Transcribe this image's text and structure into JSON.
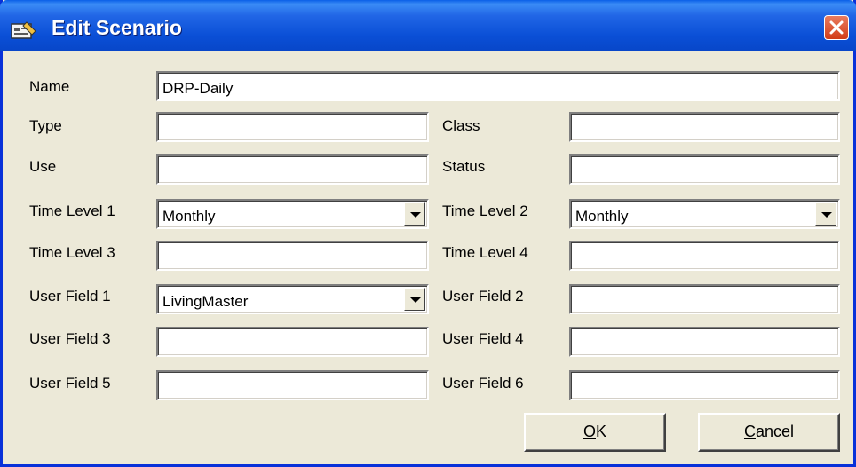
{
  "window": {
    "title": "Edit Scenario"
  },
  "labels": {
    "name": "Name",
    "type": "Type",
    "class": "Class",
    "use": "Use",
    "status": "Status",
    "time_level_1": "Time Level 1",
    "time_level_2": "Time Level 2",
    "time_level_3": "Time Level 3",
    "time_level_4": "Time Level 4",
    "user_field_1": "User Field 1",
    "user_field_2": "User Field 2",
    "user_field_3": "User Field 3",
    "user_field_4": "User Field 4",
    "user_field_5": "User Field 5",
    "user_field_6": "User Field 6"
  },
  "values": {
    "name": "DRP-Daily",
    "type": "",
    "class": "",
    "use": "",
    "status": "",
    "time_level_1": "Monthly",
    "time_level_2": "Monthly",
    "time_level_3": "",
    "time_level_4": "",
    "user_field_1": "LivingMaster",
    "user_field_2": "",
    "user_field_3": "",
    "user_field_4": "",
    "user_field_5": "",
    "user_field_6": ""
  },
  "buttons": {
    "ok_mnemonic": "O",
    "ok_rest": "K",
    "cancel_mnemonic": "C",
    "cancel_rest": "ancel"
  },
  "icons": {
    "title": "edit-scenario-icon",
    "close": "close-icon"
  }
}
